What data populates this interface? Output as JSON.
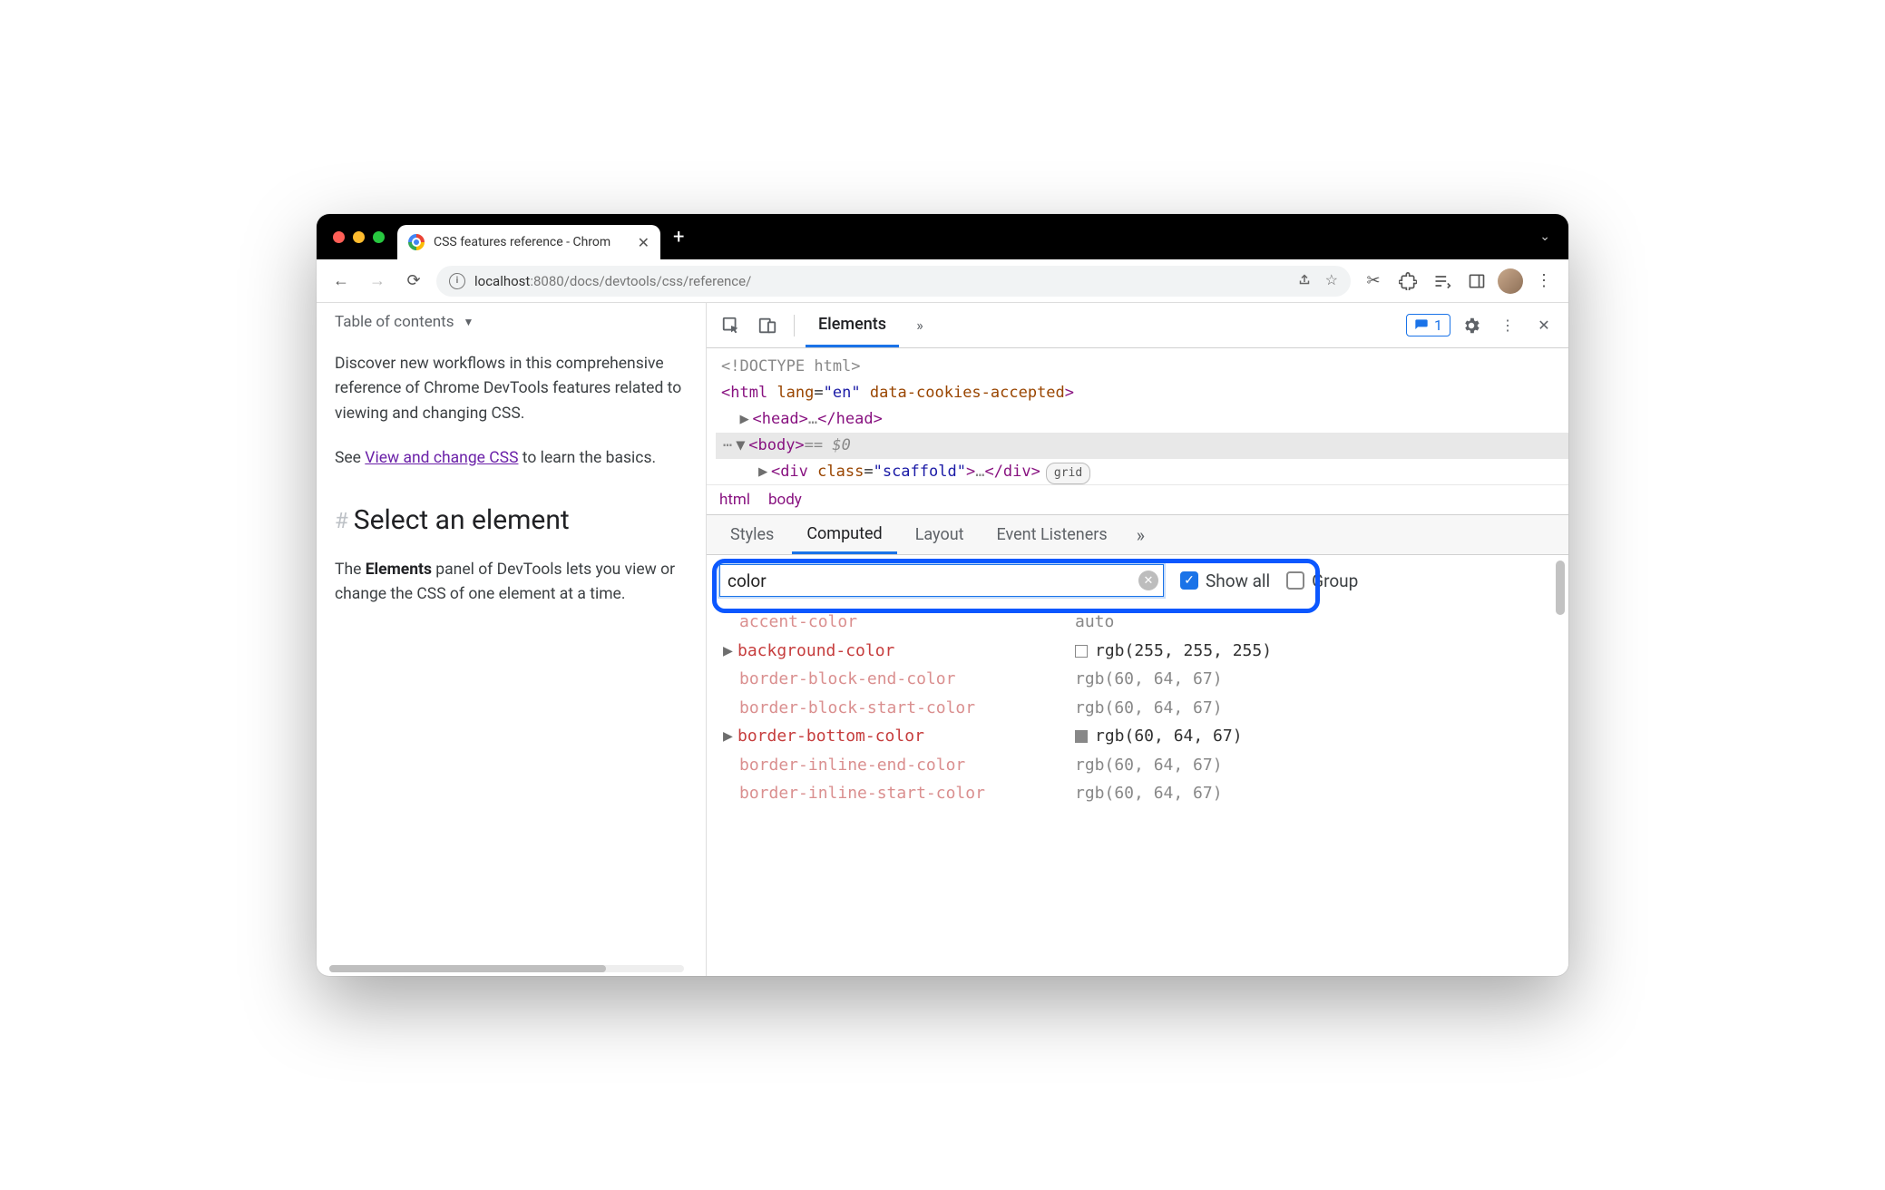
{
  "tab": {
    "title": "CSS features reference - Chrom"
  },
  "omnibox": {
    "host": "localhost",
    "port": ":8080",
    "path": "/docs/devtools/css/reference/"
  },
  "page": {
    "toc": "Table of contents",
    "intro": "Discover new workflows in this comprehensive reference of Chrome DevTools features related to viewing and changing CSS.",
    "see_prefix": "See ",
    "see_link": "View and change CSS",
    "see_suffix": " to learn the basics.",
    "h2": "Select an element",
    "body_prefix": "The ",
    "body_strong": "Elements",
    "body_suffix": " panel of DevTools lets you view or change the CSS of one element at a time."
  },
  "devtools": {
    "tabs": {
      "elements": "Elements"
    },
    "issues_count": "1",
    "dom": {
      "doctype": "<!DOCTYPE html>",
      "html_open": "<html lang=\"en\" data-cookies-accepted>",
      "head": "<head>…</head>",
      "body": "<body>",
      "body_sel": "== $0",
      "div": "<div class=\"scaffold\">…</div>",
      "grid_badge": "grid"
    },
    "crumbs": {
      "a": "html",
      "b": "body"
    },
    "subtabs": {
      "styles": "Styles",
      "computed": "Computed",
      "layout": "Layout",
      "listeners": "Event Listeners"
    },
    "filter": {
      "value": "color",
      "showall": "Show all",
      "group": "Group"
    },
    "props": [
      {
        "name": "accent-color",
        "value": "auto",
        "dim": true,
        "swatch": null,
        "expand": false
      },
      {
        "name": "background-color",
        "value": "rgb(255, 255, 255)",
        "dim": false,
        "swatch": "white",
        "expand": true
      },
      {
        "name": "border-block-end-color",
        "value": "rgb(60, 64, 67)",
        "dim": true,
        "swatch": null,
        "expand": false
      },
      {
        "name": "border-block-start-color",
        "value": "rgb(60, 64, 67)",
        "dim": true,
        "swatch": null,
        "expand": false
      },
      {
        "name": "border-bottom-color",
        "value": "rgb(60, 64, 67)",
        "dim": false,
        "swatch": "gray",
        "expand": true
      },
      {
        "name": "border-inline-end-color",
        "value": "rgb(60, 64, 67)",
        "dim": true,
        "swatch": null,
        "expand": false
      },
      {
        "name": "border-inline-start-color",
        "value": "rgb(60, 64, 67)",
        "dim": true,
        "swatch": null,
        "expand": false
      }
    ]
  }
}
